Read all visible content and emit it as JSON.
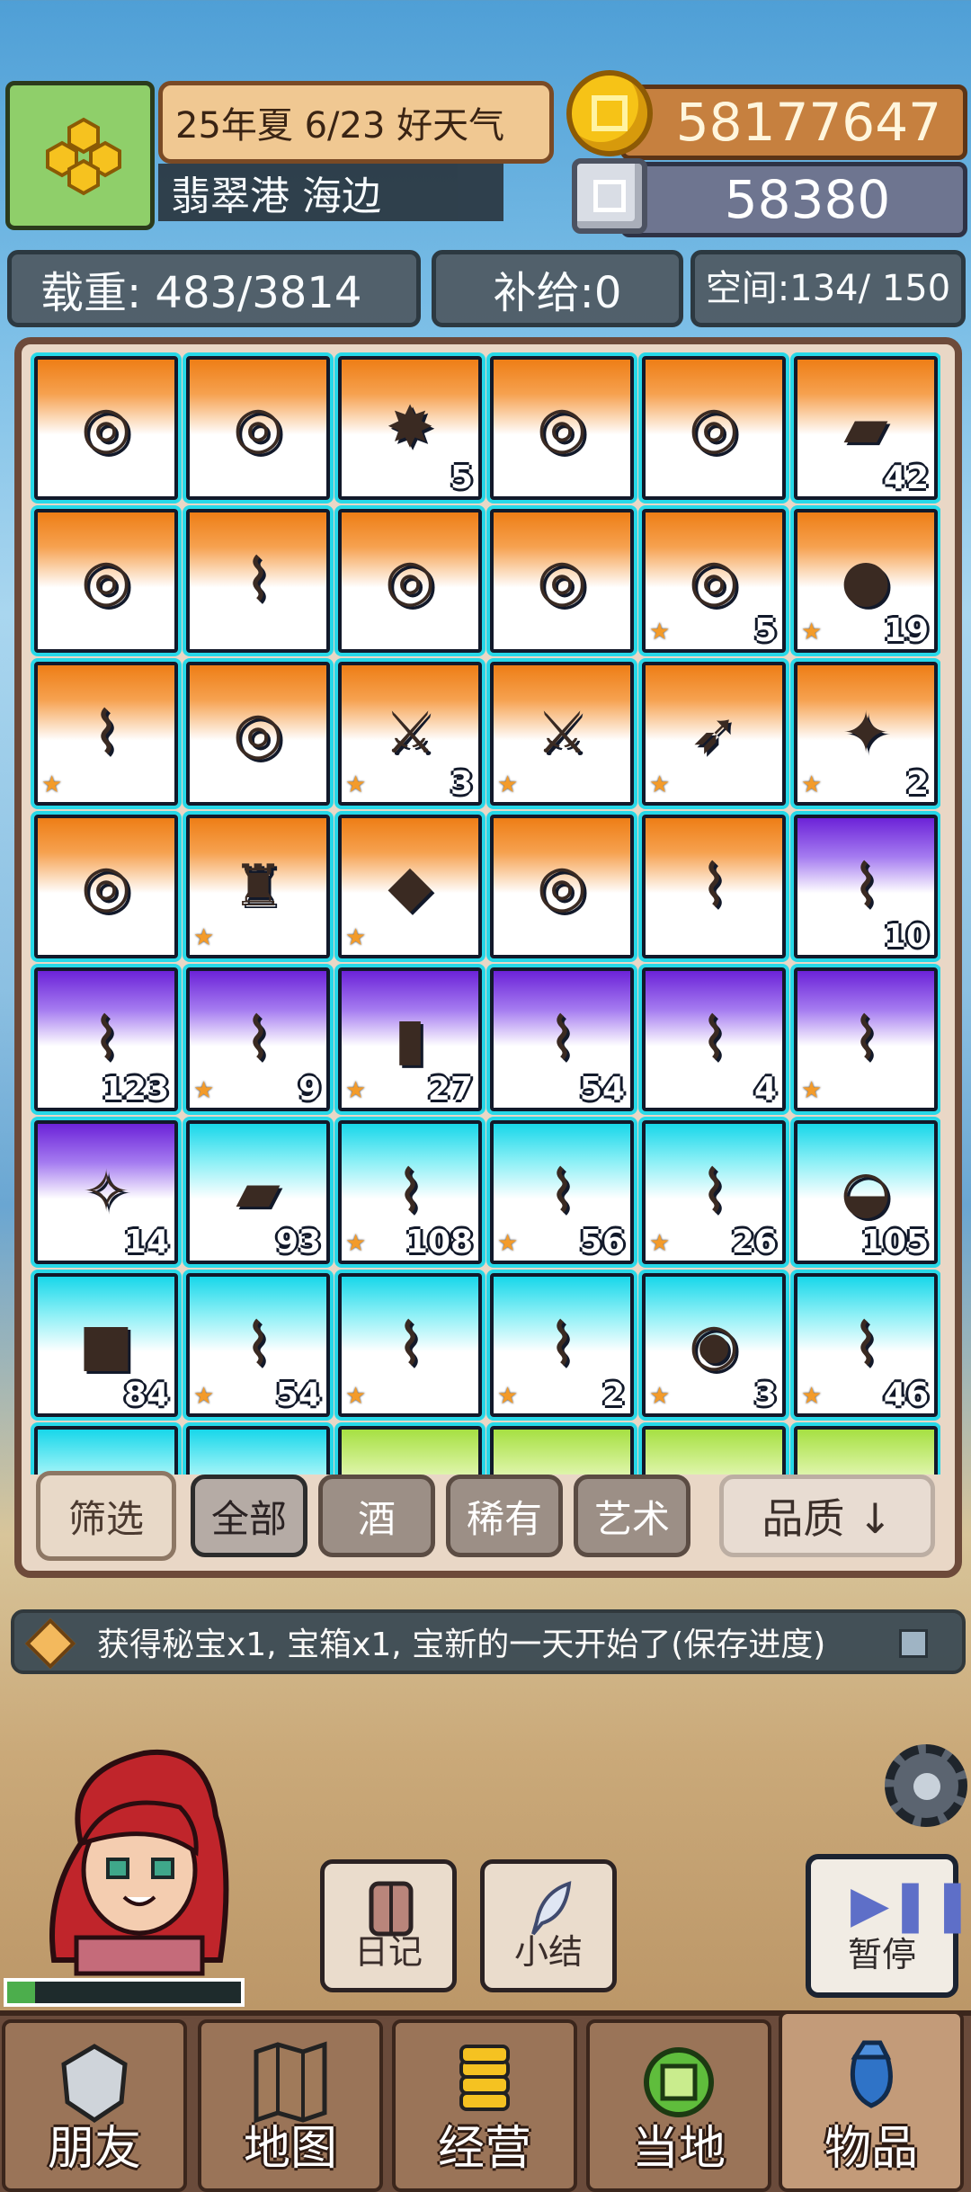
{
  "header": {
    "date_weather": "25年夏 6/23 好天气",
    "location": "翡翠港 海边",
    "gold": "58177647",
    "silver": "58380"
  },
  "stats": {
    "load": "载重: 483/3814",
    "supply": "补给:0",
    "space": "空间:134/ 150"
  },
  "inventory": {
    "slots": [
      {
        "bg": "orange",
        "icon": "silver-ring-sapphire-icon",
        "glyph": "◎",
        "count": "",
        "star": false
      },
      {
        "bg": "orange",
        "icon": "crystal-ring-icon",
        "glyph": "◎",
        "count": "",
        "star": false
      },
      {
        "bg": "orange",
        "icon": "sun-compass-icon",
        "glyph": "✸",
        "count": "5",
        "star": false
      },
      {
        "bg": "orange",
        "icon": "ruby-ring-icon",
        "glyph": "◎",
        "count": "",
        "star": false
      },
      {
        "bg": "orange",
        "icon": "amethyst-ring-icon",
        "glyph": "◎",
        "count": "",
        "star": false
      },
      {
        "bg": "orange",
        "icon": "scroll-case-icon",
        "glyph": "▰",
        "count": "42",
        "star": false
      },
      {
        "bg": "orange",
        "icon": "fire-ring-icon",
        "glyph": "◎",
        "count": "",
        "star": false
      },
      {
        "bg": "orange",
        "icon": "golden-scroll-icon",
        "glyph": "⌇",
        "count": "",
        "star": false
      },
      {
        "bg": "orange",
        "icon": "steel-ring-icon",
        "glyph": "◎",
        "count": "",
        "star": false
      },
      {
        "bg": "orange",
        "icon": "emerald-ring-icon",
        "glyph": "◎",
        "count": "",
        "star": false
      },
      {
        "bg": "orange",
        "icon": "bronze-ring-icon",
        "glyph": "◎",
        "count": "5",
        "star": true
      },
      {
        "bg": "orange",
        "icon": "leather-pouch-icon",
        "glyph": "●",
        "count": "19",
        "star": true
      },
      {
        "bg": "orange",
        "icon": "ancient-scroll-icon",
        "glyph": "⌇",
        "count": "",
        "star": true
      },
      {
        "bg": "orange",
        "icon": "violet-ring-icon",
        "glyph": "◎",
        "count": "",
        "star": false
      },
      {
        "bg": "orange",
        "icon": "flame-sword-icon",
        "glyph": "⚔",
        "count": "3",
        "star": true
      },
      {
        "bg": "orange",
        "icon": "steel-sword-icon",
        "glyph": "⚔",
        "count": "",
        "star": true
      },
      {
        "bg": "orange",
        "icon": "bow-icon",
        "glyph": "➶",
        "count": "",
        "star": true
      },
      {
        "bg": "orange",
        "icon": "crystal-staff-icon",
        "glyph": "✦",
        "count": "2",
        "star": true
      },
      {
        "bg": "orange",
        "icon": "dark-ring-icon",
        "glyph": "◎",
        "count": "",
        "star": false
      },
      {
        "bg": "orange",
        "icon": "black-dress-icon",
        "glyph": "♜",
        "count": "",
        "star": true
      },
      {
        "bg": "orange",
        "icon": "pink-diamond-icon",
        "glyph": "◆",
        "count": "",
        "star": true
      },
      {
        "bg": "orange",
        "icon": "silver-ring-icon",
        "glyph": "◎",
        "count": "",
        "star": false
      },
      {
        "bg": "orange",
        "icon": "rose-scroll-icon",
        "glyph": "⌇",
        "count": "",
        "star": false
      },
      {
        "bg": "purple",
        "icon": "pink-scroll-icon",
        "glyph": "⌇",
        "count": "10",
        "star": false
      },
      {
        "bg": "purple",
        "icon": "red-scroll-icon",
        "glyph": "⌇",
        "count": "123",
        "star": false
      },
      {
        "bg": "purple",
        "icon": "ribbon-scroll-icon",
        "glyph": "⌇",
        "count": "9",
        "star": true
      },
      {
        "bg": "purple",
        "icon": "potion-bottle-icon",
        "glyph": "▮",
        "count": "27",
        "star": true
      },
      {
        "bg": "purple",
        "icon": "blue-scroll-icon",
        "glyph": "⌇",
        "count": "54",
        "star": false
      },
      {
        "bg": "purple",
        "icon": "teal-scroll-icon",
        "glyph": "⌇",
        "count": "4",
        "star": false
      },
      {
        "bg": "purple",
        "icon": "sky-scroll-icon",
        "glyph": "⌇",
        "count": "",
        "star": true
      },
      {
        "bg": "purple",
        "icon": "compass-star-icon",
        "glyph": "✧",
        "count": "14",
        "star": false
      },
      {
        "bg": "cyan",
        "icon": "blue-cloth-icon",
        "glyph": "▰",
        "count": "93",
        "star": false
      },
      {
        "bg": "cyan",
        "icon": "parchment-scroll-icon",
        "glyph": "⌇",
        "count": "108",
        "star": true
      },
      {
        "bg": "cyan",
        "icon": "dark-scroll-icon",
        "glyph": "⌇",
        "count": "56",
        "star": true
      },
      {
        "bg": "cyan",
        "icon": "winged-scroll-icon",
        "glyph": "⌇",
        "count": "26",
        "star": true
      },
      {
        "bg": "cyan",
        "icon": "basket-icon",
        "glyph": "◒",
        "count": "105",
        "star": false
      },
      {
        "bg": "cyan",
        "icon": "white-fabric-icon",
        "glyph": "■",
        "count": "84",
        "star": false
      },
      {
        "bg": "cyan",
        "icon": "green-scroll-icon",
        "glyph": "⌇",
        "count": "54",
        "star": true
      },
      {
        "bg": "cyan",
        "icon": "bone-scroll-icon",
        "glyph": "⌇",
        "count": "",
        "star": true
      },
      {
        "bg": "cyan",
        "icon": "mint-scroll-icon",
        "glyph": "⌇",
        "count": "2",
        "star": true
      },
      {
        "bg": "cyan",
        "icon": "ammonite-icon",
        "glyph": "◉",
        "count": "3",
        "star": true
      },
      {
        "bg": "cyan",
        "icon": "flame-scroll-icon",
        "glyph": "⌇",
        "count": "46",
        "star": true
      },
      {
        "bg": "cyan",
        "icon": "chest-icon",
        "glyph": "▭",
        "count": "",
        "star": false
      },
      {
        "bg": "cyan",
        "icon": "stone-icon",
        "glyph": "◓",
        "count": "",
        "star": false
      },
      {
        "bg": "lime",
        "icon": "note-icon",
        "glyph": "▤",
        "count": "",
        "star": false
      },
      {
        "bg": "lime",
        "icon": "charm-icon",
        "glyph": "◍",
        "count": "",
        "star": false
      },
      {
        "bg": "lime",
        "icon": "fish-icon",
        "glyph": "◌",
        "count": "",
        "star": false
      },
      {
        "bg": "lime",
        "icon": "herb-icon",
        "glyph": "◌",
        "count": "",
        "star": false
      }
    ]
  },
  "filters": {
    "filter": "筛选",
    "all": "全部",
    "wine": "酒",
    "rare": "稀有",
    "art": "艺术",
    "quality": "品质 ↓"
  },
  "message": "获得秘宝x1, 宝箱x1, 宝新的一天开始了(保存进度)",
  "buttons": {
    "diary": "日记",
    "summary": "小结",
    "pause": "暂停"
  },
  "nav": {
    "friends": "朋友",
    "map": "地图",
    "manage": "经营",
    "local": "当地",
    "items": "物品"
  },
  "character_hp_fraction": 0.12
}
